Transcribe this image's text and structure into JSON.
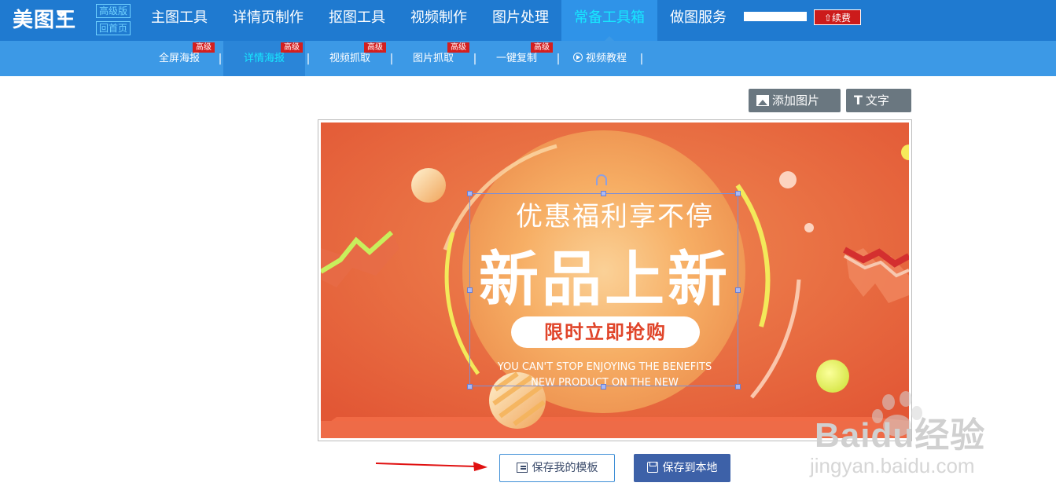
{
  "brand": {
    "logo_text": "美图王",
    "edition_badge": "高级版",
    "home_badge": "回首页"
  },
  "main_nav": [
    {
      "label": "主图工具"
    },
    {
      "label": "详情页制作"
    },
    {
      "label": "抠图工具"
    },
    {
      "label": "视频制作"
    },
    {
      "label": "图片处理"
    },
    {
      "label": "常备工具箱",
      "active": true
    },
    {
      "label": "做图服务"
    }
  ],
  "account": {
    "renew_label": "续费"
  },
  "sub_nav": [
    {
      "label": "全屏海报",
      "tag": "高级"
    },
    {
      "label": "详情海报",
      "tag": "高级",
      "active": true
    },
    {
      "label": "视频抓取",
      "tag": "高级"
    },
    {
      "label": "图片抓取",
      "tag": "高级"
    },
    {
      "label": "一键复制",
      "tag": "高级"
    },
    {
      "label": "视频教程",
      "icon": "play-circle-icon"
    }
  ],
  "toolbar": {
    "add_image_label": "添加图片",
    "text_label": "文字"
  },
  "poster": {
    "line1": "优惠福利享不停",
    "line2": "新品上新",
    "pill": "限时立即抢购",
    "en_line1": "YOU CAN'T STOP ENJOYING THE BENEFITS",
    "en_line2": "NEW PRODUCT ON THE NEW"
  },
  "actions": {
    "save_template_label": "保存我的模板",
    "save_local_label": "保存到本地"
  },
  "watermark": {
    "brand": "Baidu经验",
    "url": "jingyan.baidu.com"
  },
  "colors": {
    "nav": "#1f7ad0",
    "subnav": "#3c99e6",
    "active_text": "#17e8ff",
    "tag_red": "#d41f1f",
    "save_local": "#3d61a8",
    "poster_bg": "#e4603a"
  }
}
